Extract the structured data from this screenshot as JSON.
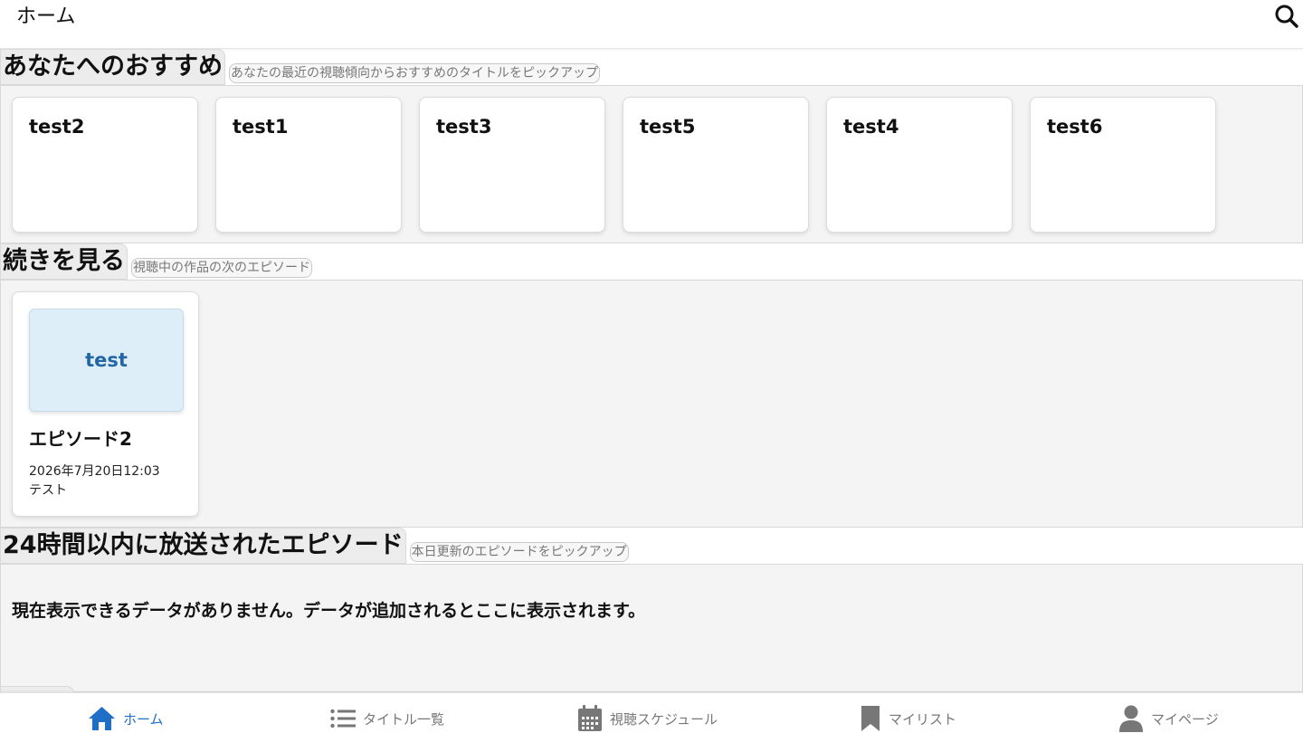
{
  "header": {
    "title": "ホーム"
  },
  "recommend": {
    "title": "あなたへのおすすめ",
    "subtitle": "あなたの最近の視聴傾向からおすすめのタイトルをピックアップ",
    "items": [
      {
        "title": "test2"
      },
      {
        "title": "test1"
      },
      {
        "title": "test3"
      },
      {
        "title": "test5"
      },
      {
        "title": "test4"
      },
      {
        "title": "test6"
      }
    ]
  },
  "continue": {
    "title": "続きを見る",
    "subtitle": "視聴中の作品の次のエピソード",
    "items": [
      {
        "thumb_text": "test",
        "episode": "エピソード2",
        "date": "2026年7月20日12:03",
        "series": "テスト"
      }
    ]
  },
  "recent": {
    "title": "24時間以内に放送されたエピソード",
    "subtitle": "本日更新のエピソードをピックアップ",
    "empty_message": "現在表示できるデータがありません。データが追加されるとここに表示されます。"
  },
  "nav": {
    "items": [
      {
        "label": "ホーム",
        "icon": "home-icon",
        "active": true
      },
      {
        "label": "タイトル一覧",
        "icon": "list-icon",
        "active": false
      },
      {
        "label": "視聴スケジュール",
        "icon": "calendar-icon",
        "active": false
      },
      {
        "label": "マイリスト",
        "icon": "bookmark-icon",
        "active": false
      },
      {
        "label": "マイページ",
        "icon": "person-icon",
        "active": false
      }
    ]
  },
  "colors": {
    "accent": "#1f6fc7",
    "thumb_bg": "#deeef8",
    "thumb_text": "#2366a6",
    "section_bg": "#f4f4f4"
  }
}
